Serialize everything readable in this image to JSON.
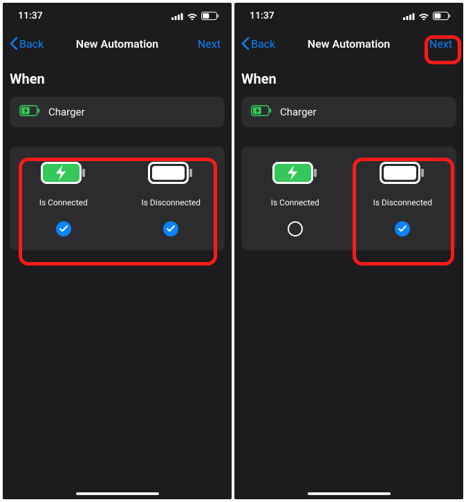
{
  "status": {
    "time": "11:37"
  },
  "nav": {
    "back": "Back",
    "title": "New Automation",
    "next": "Next"
  },
  "section": {
    "when": "When",
    "charger": "Charger"
  },
  "options": {
    "connected": "Is Connected",
    "disconnected": "Is Disconnected"
  },
  "screens": {
    "left": {
      "connected_checked": true,
      "disconnected_checked": true
    },
    "right": {
      "connected_checked": false,
      "disconnected_checked": true
    }
  },
  "colors": {
    "accent": "#0a84ff",
    "green": "#34c759",
    "highlight": "#ff1a1a"
  }
}
